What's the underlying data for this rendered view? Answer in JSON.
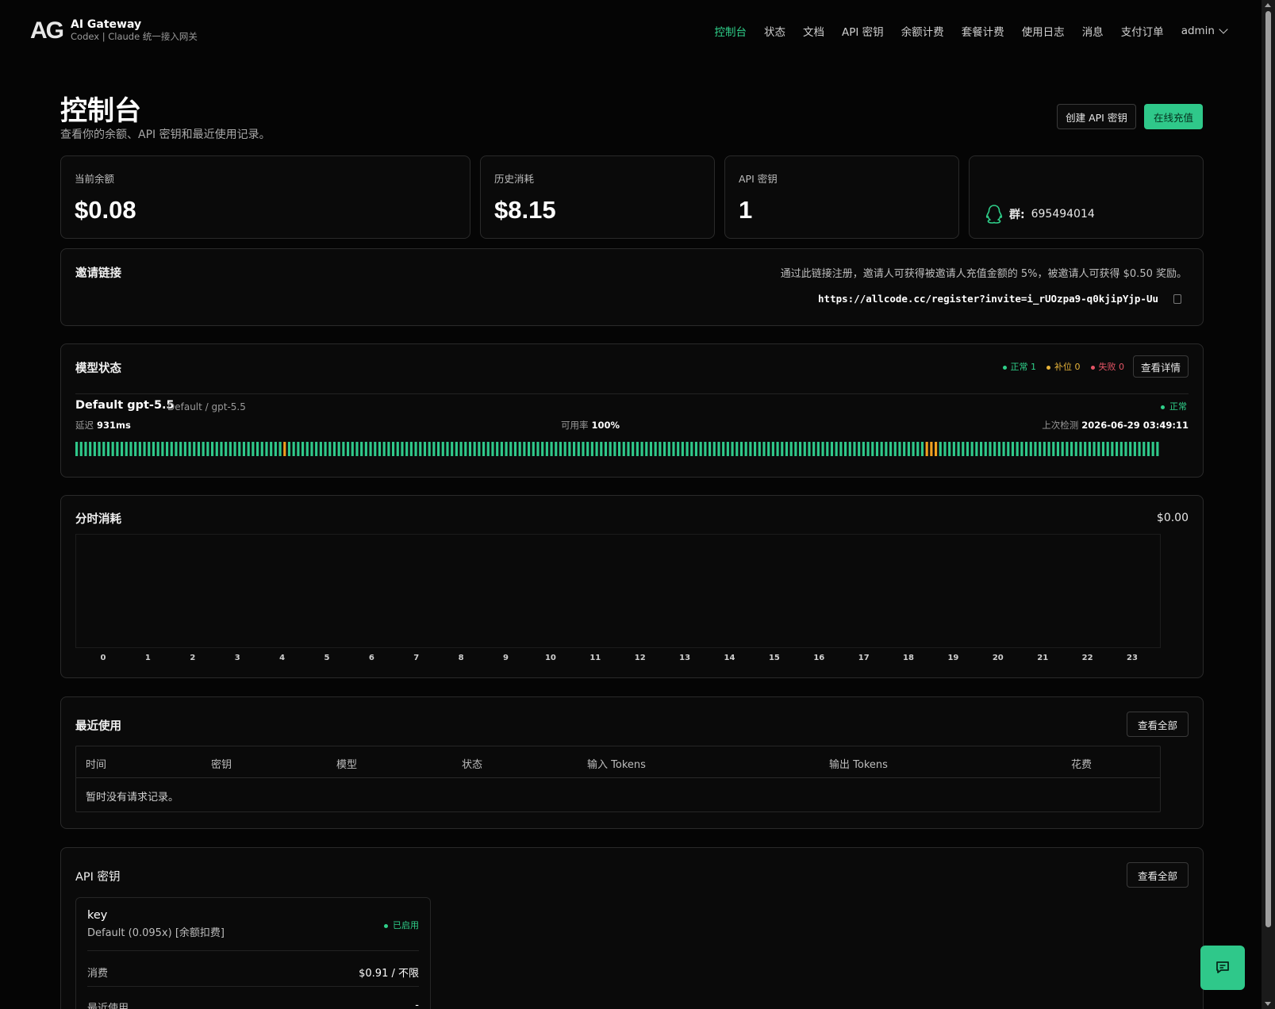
{
  "header": {
    "logo_mark": "AG",
    "app_name": "AI Gateway",
    "app_subtitle": "Codex | Claude 统一接入网关",
    "nav": [
      "控制台",
      "状态",
      "文档",
      "API 密钥",
      "余额计费",
      "套餐计费",
      "使用日志",
      "消息",
      "支付订单"
    ],
    "user": "admin"
  },
  "page": {
    "title": "控制台",
    "subtitle": "查看你的余额、API 密钥和最近使用记录。",
    "create_key_button": "创建 API 密钥",
    "recharge_button": "在线充值"
  },
  "stats": {
    "balance_label": "当前余额",
    "balance_value": "$0.08",
    "history_label": "历史消耗",
    "history_value": "$8.15",
    "keys_label": "API 密钥",
    "keys_value": "1",
    "qq_label": "群:",
    "qq_value": "695494014"
  },
  "invite": {
    "title": "邀请链接",
    "description": "通过此链接注册，邀请人可获得被邀请人充值金额的 5%，被邀请人可获得 $0.50 奖励。",
    "link": "https://allcode.cc/register?invite=i_rUOzpa9-q0kjipYjp-Uu"
  },
  "model_status": {
    "title": "模型状态",
    "legend_ok": "正常 1",
    "legend_warn": "补位 0",
    "legend_fail": "失败 0",
    "details_button": "查看详情",
    "model_name": "Default gpt-5.5",
    "model_meta": "Default / gpt-5.5",
    "status": "正常",
    "latency_label": "延迟",
    "latency_value": "931ms",
    "uptime_label": "可用率",
    "uptime_value": "100%",
    "last_check_label": "上次检测",
    "last_check_value": "2026-06-29 03:49:11",
    "history": {
      "count": 240,
      "warn_indices": [
        46,
        188,
        189,
        190
      ]
    },
    "colors": {
      "ok": "#2fc88a",
      "warn": "#f0a020"
    }
  },
  "hourly": {
    "title": "分时消耗",
    "total": "$0.00",
    "chart_data": {
      "type": "bar",
      "categories": [
        "0",
        "1",
        "2",
        "3",
        "4",
        "5",
        "6",
        "7",
        "8",
        "9",
        "10",
        "11",
        "12",
        "13",
        "14",
        "15",
        "16",
        "17",
        "18",
        "19",
        "20",
        "21",
        "22",
        "23"
      ],
      "values": [
        0,
        0,
        0,
        0,
        0,
        0,
        0,
        0,
        0,
        0,
        0,
        0,
        0,
        0,
        0,
        0,
        0,
        0,
        0,
        0,
        0,
        0,
        0,
        0
      ]
    }
  },
  "recent": {
    "title": "最近使用",
    "view_all": "查看全部",
    "columns": [
      "时间",
      "密钥",
      "模型",
      "状态",
      "输入 Tokens",
      "输出 Tokens",
      "花费"
    ],
    "empty": "暂时没有请求记录。"
  },
  "api_keys": {
    "title": "API 密钥",
    "view_all": "查看全部",
    "key": {
      "name": "key",
      "desc": "Default (0.095x) [余额扣费]",
      "status": "已启用",
      "usage_label": "消费",
      "usage_value": "$0.91 / 不限",
      "last_used_label": "最近使用",
      "last_used_value": "-"
    }
  },
  "icons": {
    "qq": "qq-penguin-icon",
    "copy": "copy-icon",
    "chat": "chat-bubble-icon",
    "chevron": "chevron-down-icon"
  }
}
